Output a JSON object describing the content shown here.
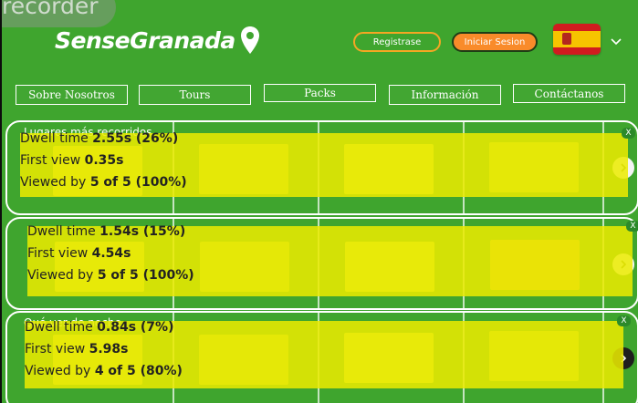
{
  "recorder": {
    "label": "recorder"
  },
  "header": {
    "logo_text": "SenseGranada",
    "register_label": "Registrase",
    "login_label": "Iniciar Sesion",
    "language": "es"
  },
  "nav": {
    "items": [
      {
        "label": "Sobre Nosotros"
      },
      {
        "label": "Tours"
      },
      {
        "label": "Packs"
      },
      {
        "label": "Información"
      },
      {
        "label": "Contáctanos"
      }
    ]
  },
  "sections": [
    {
      "title": "Lugares más recorridos"
    },
    {
      "title": ""
    },
    {
      "title": "Qué ver de noche"
    }
  ],
  "overlays": [
    {
      "dwell_label": "Dwell time",
      "dwell_value": "2.55s (26%)",
      "first_label": "First view",
      "first_value": "0.35s",
      "viewed_label": "Viewed by",
      "viewed_value": "5 of 5 (100%)",
      "close": "X"
    },
    {
      "dwell_label": "Dwell time",
      "dwell_value": "1.54s (15%)",
      "first_label": "First view",
      "first_value": "4.54s",
      "viewed_label": "Viewed by",
      "viewed_value": "5 of 5 (100%)",
      "close": "X"
    },
    {
      "dwell_label": "Dwell time",
      "dwell_value": "0.84s (7%)",
      "first_label": "First view",
      "first_value": "5.98s",
      "viewed_label": "Viewed by",
      "viewed_value": "4 of 5 (80%)",
      "close": "X"
    }
  ],
  "colors": {
    "background": "#3fa52e",
    "overlay": "#ebeb00",
    "accent": "#f98b2a",
    "outline": "#f5a623"
  },
  "icons": {
    "logo_pin": "map-pin-icon",
    "next": "chevron-right-icon",
    "language_menu": "chevron-down-icon",
    "close": "close-icon"
  }
}
